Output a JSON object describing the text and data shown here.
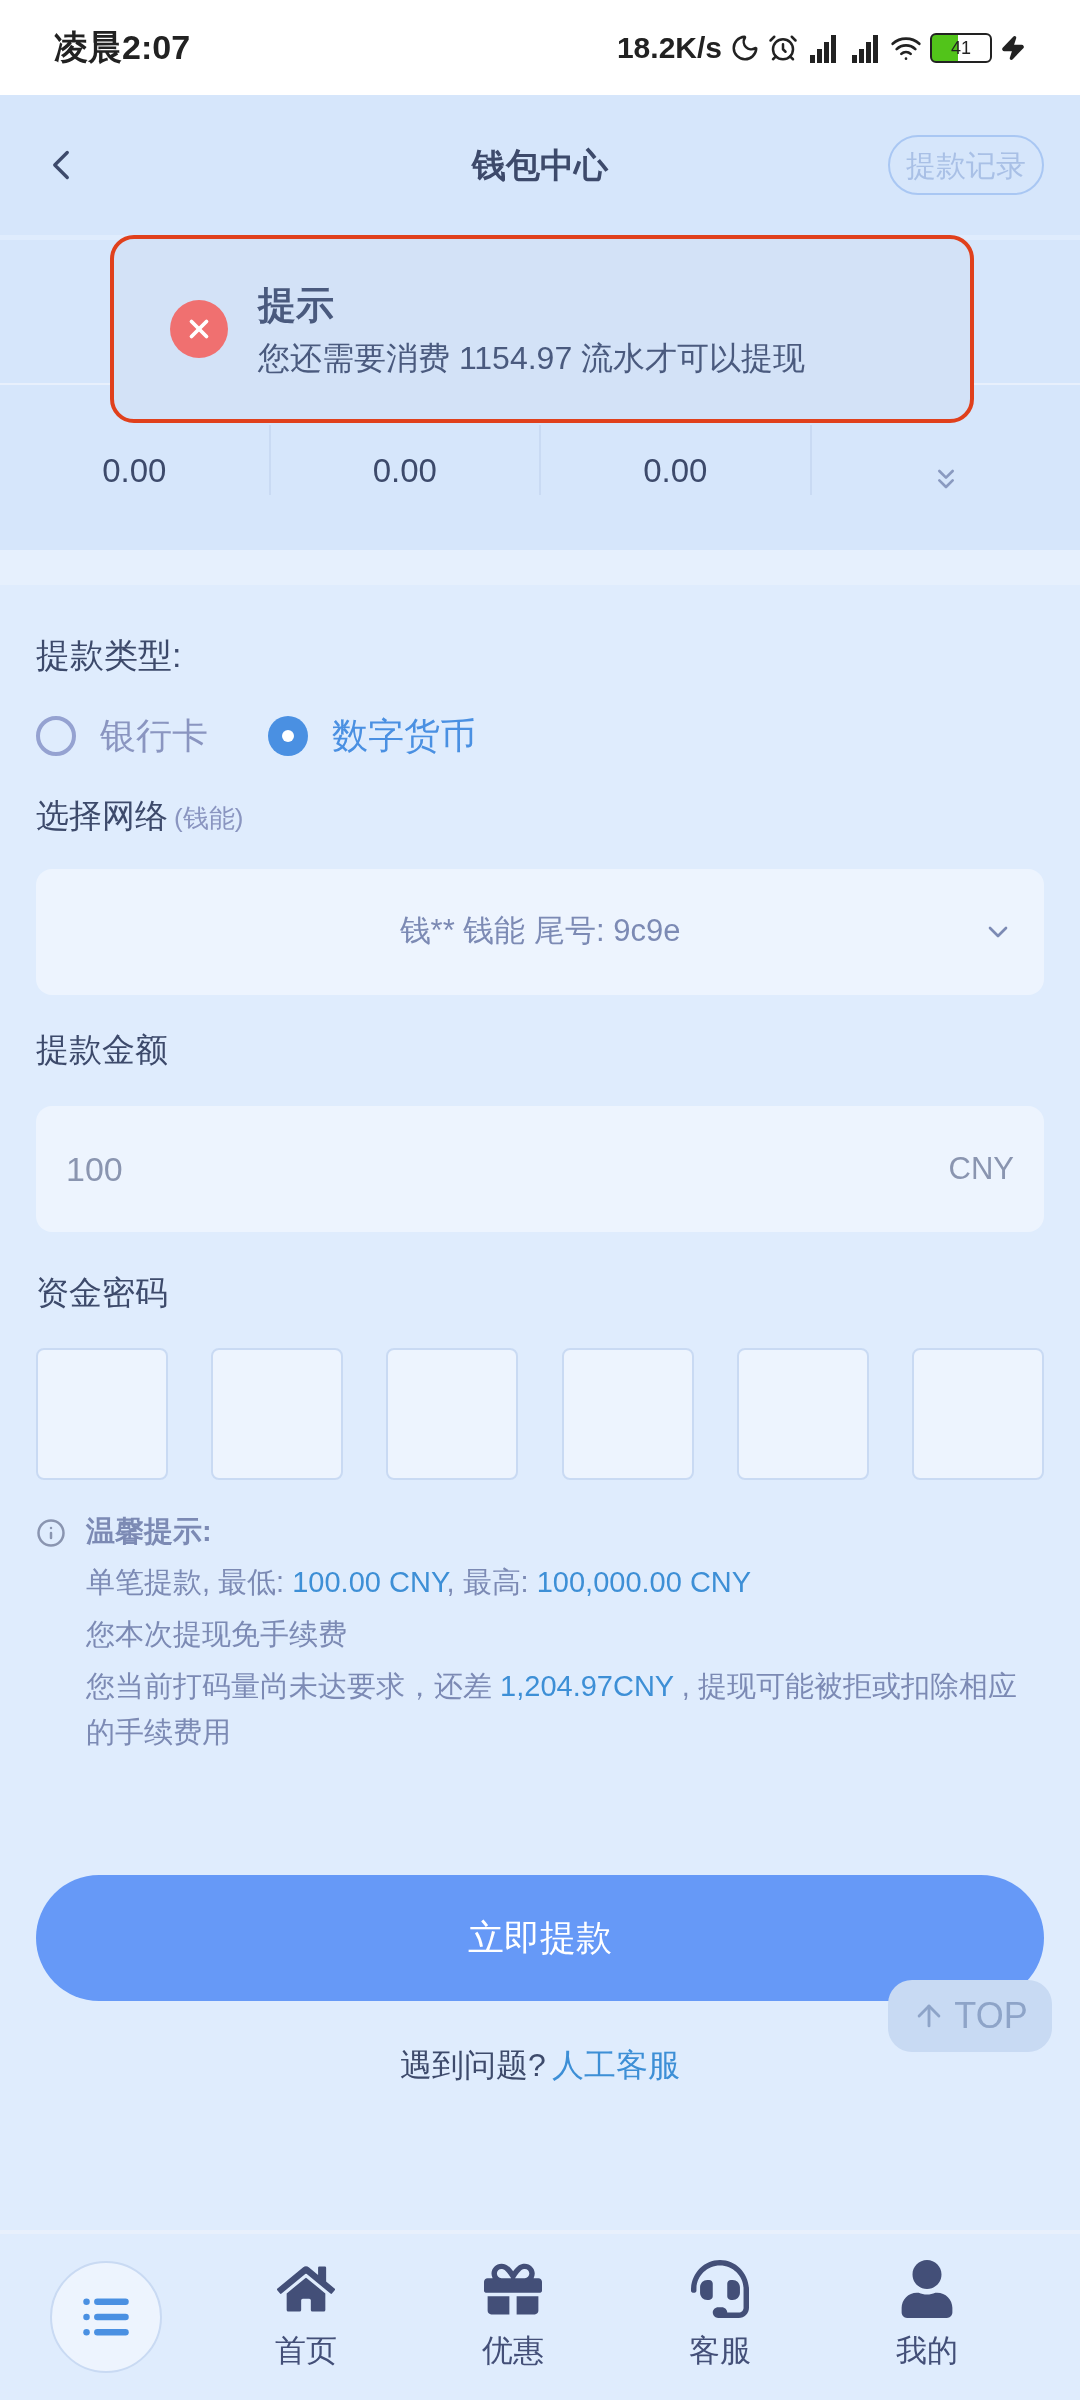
{
  "status_bar": {
    "time": "凌晨2:07",
    "speed": "18.2K/s",
    "battery": "41"
  },
  "header": {
    "title": "钱包中心",
    "history_button": "提款记录"
  },
  "balances": [
    {
      "value": "0.00"
    },
    {
      "value": "0.00"
    },
    {
      "value": "0.00"
    }
  ],
  "toast": {
    "title": "提示",
    "message": "您还需要消费 1154.97 流水才可以提现"
  },
  "form": {
    "type_label": "提款类型:",
    "types": [
      {
        "label": "银行卡",
        "selected": false
      },
      {
        "label": "数字货币",
        "selected": true
      }
    ],
    "network_label": "选择网络",
    "network_hint": "(钱能)",
    "network_value": "钱** 钱能 尾号: 9c9e",
    "amount_label": "提款金额",
    "amount_value": "100",
    "currency": "CNY",
    "pin_label": "资金密码"
  },
  "tips": {
    "title": "温馨提示:",
    "lines": [
      [
        {
          "text": "单笔提款, 最低: ",
          "highlight": false
        },
        {
          "text": "100.00 CNY",
          "highlight": true
        },
        {
          "text": ", 最高: ",
          "highlight": false
        },
        {
          "text": "100,000.00 CNY",
          "highlight": true
        }
      ],
      [
        {
          "text": "您本次提现免手续费",
          "highlight": false
        }
      ],
      [
        {
          "text": "您当前打码量尚未达要求，还差 ",
          "highlight": false
        },
        {
          "text": "1,204.97CNY",
          "highlight": true
        },
        {
          "text": " , 提现可能被拒或扣除相应的手续费用",
          "highlight": false
        }
      ]
    ]
  },
  "submit_button": "立即提款",
  "top_button": "TOP",
  "help": {
    "text": "遇到问题?",
    "link": "人工客服"
  },
  "nav": [
    {
      "label": "首页",
      "kind": "home"
    },
    {
      "label": "优惠",
      "kind": "gift"
    },
    {
      "label": "客服",
      "kind": "support"
    },
    {
      "label": "我的",
      "kind": "user"
    }
  ]
}
